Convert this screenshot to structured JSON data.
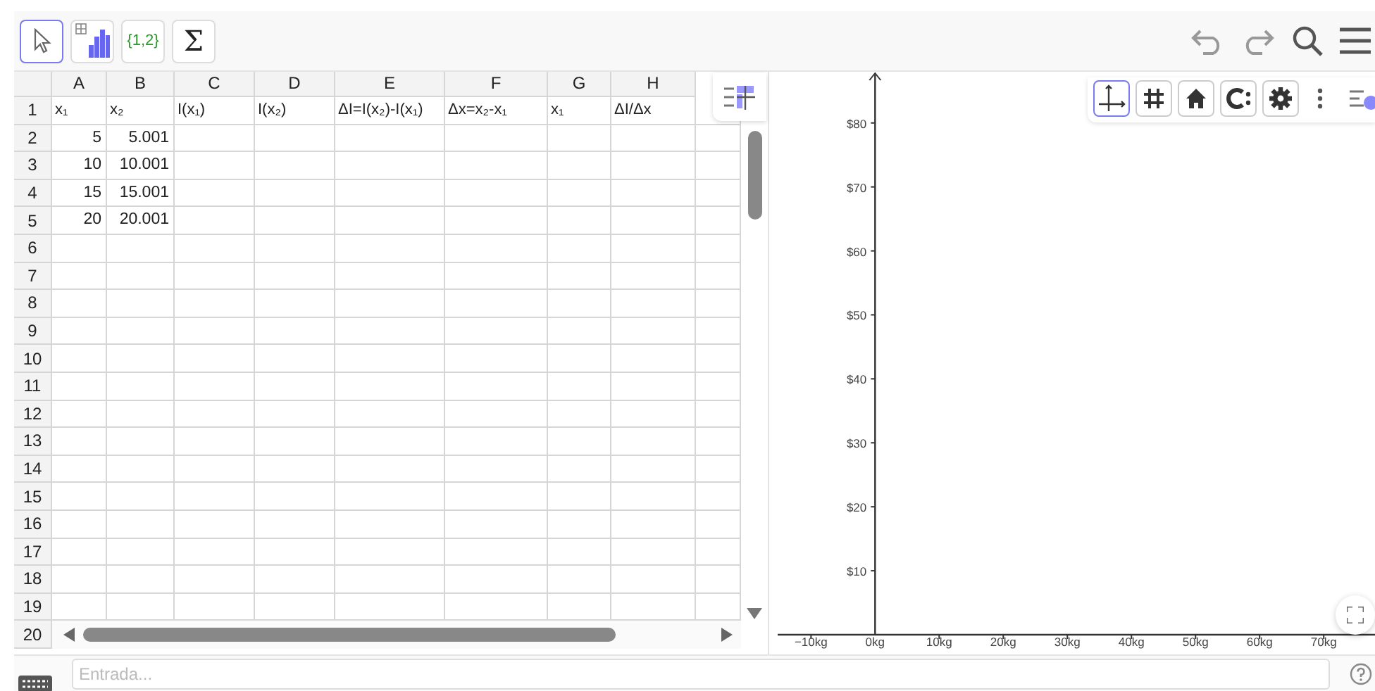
{
  "toolbar": {
    "tools": [
      {
        "kind": "move",
        "selected": true
      },
      {
        "kind": "chart",
        "selected": false
      },
      {
        "kind": "list",
        "label": "{1,2}",
        "selected": false
      },
      {
        "kind": "sum",
        "label": "Σ",
        "selected": false
      }
    ]
  },
  "spreadsheet": {
    "columns": [
      "A",
      "B",
      "C",
      "D",
      "E",
      "F",
      "G",
      "H"
    ],
    "rows": [
      {
        "number": "1",
        "kind": "text",
        "cells": [
          "x₁",
          "x₂",
          "I(x₁)",
          "I(x₂)",
          "ΔI=I(x₂)-I(x₁)",
          "Δx=x₂-x₁",
          "x₁",
          "ΔI/Δx"
        ]
      },
      {
        "number": "2",
        "kind": "number",
        "cells": [
          "5",
          "5.001"
        ]
      },
      {
        "number": "3",
        "kind": "number",
        "cells": [
          "10",
          "10.001"
        ]
      },
      {
        "number": "4",
        "kind": "number",
        "cells": [
          "15",
          "15.001"
        ]
      },
      {
        "number": "5",
        "kind": "number",
        "cells": [
          "20",
          "20.001"
        ]
      },
      {
        "number": "6"
      },
      {
        "number": "7"
      },
      {
        "number": "8"
      },
      {
        "number": "9"
      },
      {
        "number": "10"
      },
      {
        "number": "11"
      },
      {
        "number": "12"
      },
      {
        "number": "13"
      },
      {
        "number": "14"
      },
      {
        "number": "15"
      },
      {
        "number": "16"
      },
      {
        "number": "17"
      },
      {
        "number": "18"
      },
      {
        "number": "19"
      },
      {
        "number": "20"
      }
    ]
  },
  "graphics": {
    "tools": [
      {
        "kind": "axes",
        "selected": true
      },
      {
        "kind": "grid",
        "selected": false
      },
      {
        "kind": "home",
        "selected": false
      },
      {
        "kind": "style",
        "selected": false
      },
      {
        "kind": "settings",
        "selected": false
      }
    ],
    "chart_data": {
      "type": "scatter",
      "xlim": [
        -15.2,
        78
      ],
      "ylim": [
        0,
        88
      ],
      "xticks": [
        {
          "value": -10,
          "label": "−10kg"
        },
        {
          "value": 0,
          "label": "0kg"
        },
        {
          "value": 10,
          "label": "10kg"
        },
        {
          "value": 20,
          "label": "20kg"
        },
        {
          "value": 30,
          "label": "30kg"
        },
        {
          "value": 40,
          "label": "40kg"
        },
        {
          "value": 50,
          "label": "50kg"
        },
        {
          "value": 60,
          "label": "60kg"
        },
        {
          "value": 70,
          "label": "70kg"
        }
      ],
      "yticks": [
        {
          "value": 10,
          "label": "$10"
        },
        {
          "value": 20,
          "label": "$20"
        },
        {
          "value": 30,
          "label": "$30"
        },
        {
          "value": 40,
          "label": "$40"
        },
        {
          "value": 50,
          "label": "$50"
        },
        {
          "value": 60,
          "label": "$60"
        },
        {
          "value": 70,
          "label": "$70"
        },
        {
          "value": 80,
          "label": "$80"
        }
      ]
    }
  },
  "input": {
    "placeholder": "Entrada..."
  }
}
